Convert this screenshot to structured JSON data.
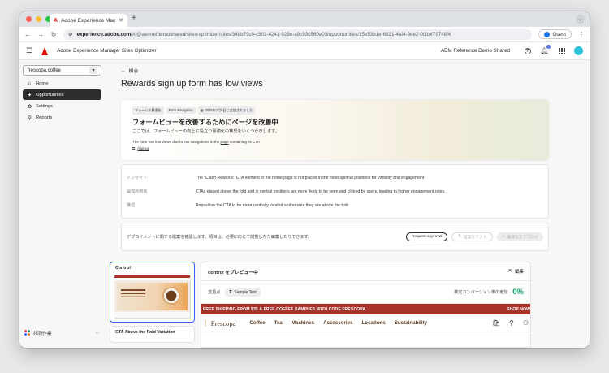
{
  "colors": {
    "accent": "#3b63fb",
    "adobe_red": "#eb1000",
    "promo_bar": "#a8342c",
    "conversion_green": "#12a368",
    "traffic_red": "#ff5f57",
    "traffic_yellow": "#febc2e",
    "traffic_green": "#28c840"
  },
  "browser": {
    "tab_title": "Adobe Experience Manager S",
    "new_tab": "+",
    "url_host": "experience.adobe.com",
    "url_path": "/#/@aemrefdemoshared/sites-optimizer/sites/34bb79c0-c901-4241-929e-a9c930560e03/opportunities/15e53b1e-6821-4af4-9ee2-0f1b479748f4",
    "guest_label": "Guest"
  },
  "header": {
    "app_title": "Adobe Experience Manager Sites Optimizer",
    "org_name": "AEM Reference Demo Shared",
    "notification_count": "1"
  },
  "sidebar": {
    "site_selector": "frescopa.coffee",
    "items": [
      {
        "label": "Home",
        "icon": "home-icon",
        "active": false
      },
      {
        "label": "Opportunities",
        "icon": "opportunities-icon",
        "active": true
      },
      {
        "label": "Settings",
        "icon": "gear-icon",
        "active": false
      },
      {
        "label": "Reports",
        "icon": "reports-icon",
        "active": false
      }
    ],
    "footer_label": "共同作業"
  },
  "main": {
    "back_label": "機会",
    "page_title": "Rewards sign up form has low views",
    "hero": {
      "badges": [
        "フォームの最適化",
        "Form Navigation"
      ],
      "date_label": "2025年7月9日に追加されました",
      "title": "フォームビューを改善するためにページを改善中",
      "subtitle": "ここでは、フォームビューの向上に役立つ最適化の推奨をいくつか示します。",
      "note_prefix": "The form has low views due to low navigations in the ",
      "note_link": "page",
      "note_suffix": " containing its CTA",
      "link_label": "/signup"
    },
    "details": [
      {
        "label": "インサイト",
        "value": "The \"Claim Rewards\" CTA element in the home page is not placed in the most optimal positions for visibility and engagement"
      },
      {
        "label": "論理的根拠",
        "value": "CTAs placed above the fold and in central positions are more likely to be seen and clicked by users, leading to higher engagement rates."
      },
      {
        "label": "推奨",
        "value": "Reposition the CTA to be more centrally located and ensure they are above the fold."
      }
    ],
    "deploy": {
      "text": "デプロイメントに関する提案を確認します。項目は、必要に応じて閲覧したり編集したりできます。",
      "request_label": "Request approval",
      "test_label": "提案をテスト",
      "deploy_label": "最適化をデプロイ"
    }
  },
  "variations": [
    {
      "name": "Control",
      "selected": true
    },
    {
      "name": "CTA Above the Fold Variation",
      "selected": false
    }
  ],
  "preview": {
    "title": "control をプレビュー中",
    "edit_label": "編集",
    "change_label": "変更点",
    "change_chip": "Sample Text",
    "conversion_label": "推定コンバージョン率の増加",
    "conversion_value": "0%",
    "promo_text": "FREE SHIPPING FROM $35 & FREE COFFEE SAMPLES WITH CODE FRESCOPA.",
    "promo_cta": "SHOP NOW",
    "brand": "Frescopa",
    "nav": [
      "Coffee",
      "Tea",
      "Machines",
      "Accessories",
      "Locations",
      "Sustainability"
    ],
    "nav_icons": [
      "cart-icon",
      "search-icon",
      "account-icon"
    ]
  }
}
